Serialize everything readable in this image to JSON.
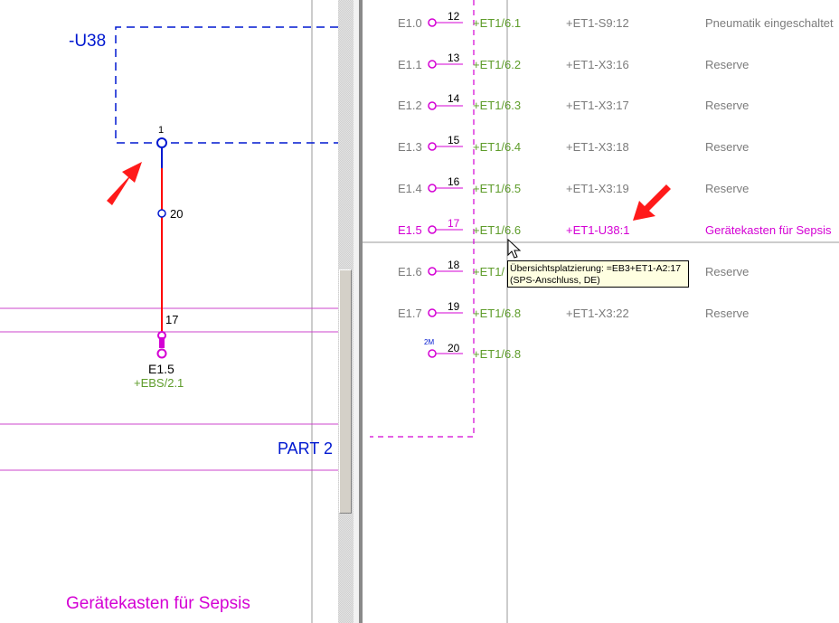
{
  "left_panel": {
    "device_tag": "-U38",
    "pin_top": "1",
    "pin_mid": "20",
    "wire_num": "17",
    "terminal_label": "E1.5",
    "terminal_ref": "+EBS/2.1",
    "part_label": "PART 2",
    "footer_text": "Gerätekasten für Sepsis"
  },
  "rows": [
    {
      "io": "E1.0",
      "pin": "12",
      "ref": "+ET1/6.1",
      "dest": "+ET1-S9:12",
      "desc": "Pneumatik eingeschaltet"
    },
    {
      "io": "E1.1",
      "pin": "13",
      "ref": "+ET1/6.2",
      "dest": "+ET1-X3:16",
      "desc": "Reserve"
    },
    {
      "io": "E1.2",
      "pin": "14",
      "ref": "+ET1/6.3",
      "dest": "+ET1-X3:17",
      "desc": "Reserve"
    },
    {
      "io": "E1.3",
      "pin": "15",
      "ref": "+ET1/6.4",
      "dest": "+ET1-X3:18",
      "desc": "Reserve"
    },
    {
      "io": "E1.4",
      "pin": "16",
      "ref": "+ET1/6.5",
      "dest": "+ET1-X3:19",
      "desc": "Reserve"
    },
    {
      "io": "E1.5",
      "pin": "17",
      "ref": "+ET1/6.6",
      "dest": "+ET1-U38:1",
      "desc": "Gerätekasten für Sepsis",
      "highlight": true
    },
    {
      "io": "E1.6",
      "pin": "18",
      "ref": "+ET1/",
      "dest": "",
      "desc": "Reserve"
    },
    {
      "io": "E1.7",
      "pin": "19",
      "ref": "+ET1/6.8",
      "dest": "+ET1-X3:22",
      "desc": "Reserve"
    },
    {
      "io": "",
      "pin": "20",
      "ref": "+ET1/6.8",
      "dest": "",
      "desc": "",
      "prefix": "2M"
    }
  ],
  "tooltip": {
    "line1": "Übersichtsplatzierung: =EB3+ET1-A2:17",
    "line2": "(SPS-Anschluss, DE)"
  },
  "colors": {
    "magenta": "#d400d4",
    "green": "#5e9c2a",
    "blue": "#0018d0",
    "red": "#ff0000",
    "label_gray": "#7c7c7c",
    "arrow": "#ff1a1a"
  }
}
